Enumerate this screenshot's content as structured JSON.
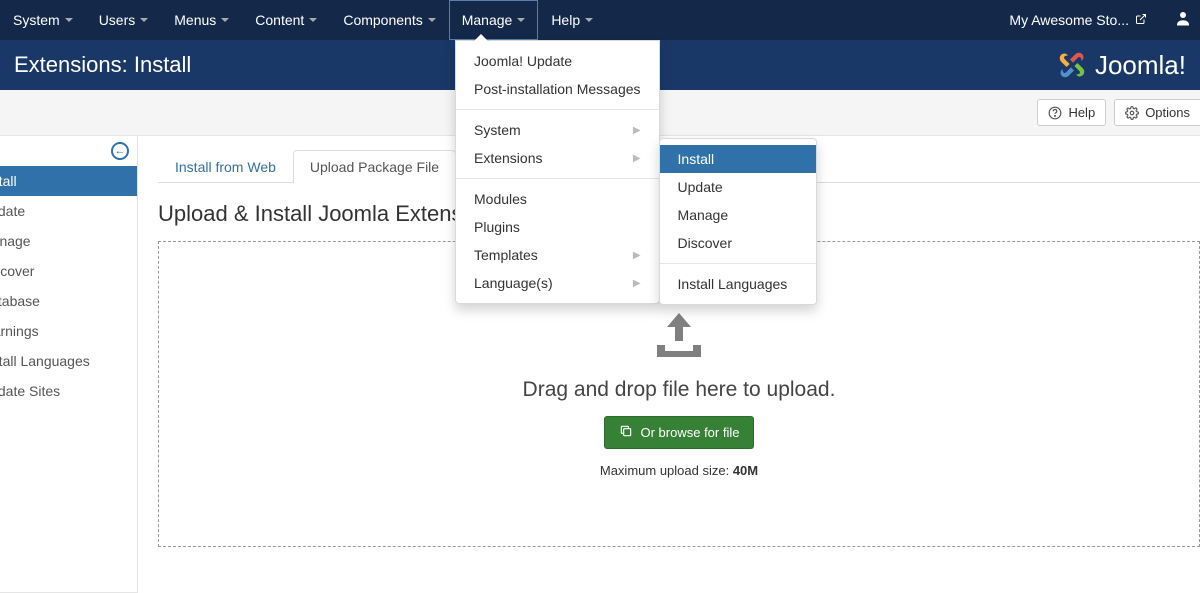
{
  "topnav": {
    "items": [
      "System",
      "Users",
      "Menus",
      "Content",
      "Components",
      "Manage",
      "Help"
    ],
    "site_name": "My Awesome Sto..."
  },
  "header": {
    "title": "Extensions: Install",
    "brand": "Joomla!"
  },
  "toolbar": {
    "help": "Help",
    "options": "Options"
  },
  "sidebar": {
    "items": [
      "Install",
      "Update",
      "Manage",
      "Discover",
      "Database",
      "Warnings",
      "Install Languages",
      "Update Sites"
    ]
  },
  "tabs": {
    "install_from_web": "Install from Web",
    "upload_package": "Upload Package File"
  },
  "main": {
    "heading": "Upload & Install Joomla Extension",
    "drop_text": "Drag and drop file here to upload.",
    "browse_label": "Or browse for file",
    "max_upload_label": "Maximum upload size: ",
    "max_upload_value": "40M"
  },
  "dropdown": {
    "joomla_update": "Joomla! Update",
    "post_install": "Post-installation Messages",
    "system": "System",
    "extensions": "Extensions",
    "modules": "Modules",
    "plugins": "Plugins",
    "templates": "Templates",
    "languages": "Language(s)",
    "sub": {
      "install": "Install",
      "update": "Update",
      "manage": "Manage",
      "discover": "Discover",
      "install_languages": "Install Languages"
    }
  }
}
